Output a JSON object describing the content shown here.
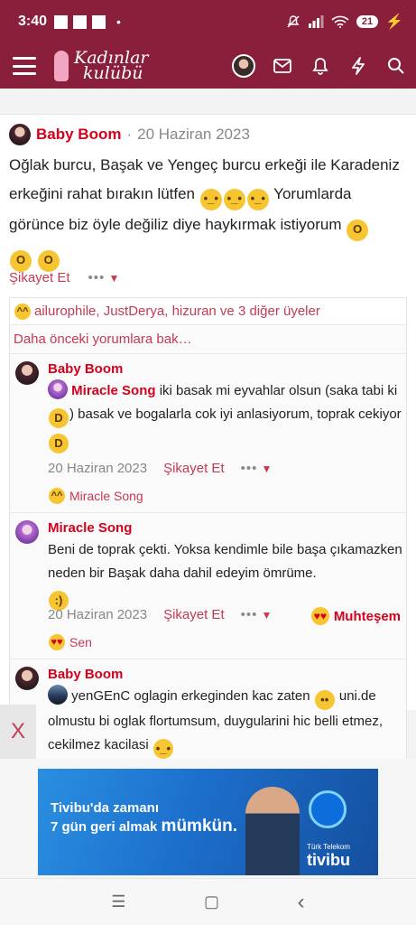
{
  "status_bar": {
    "time": "3:40",
    "battery": "21"
  },
  "app_bar": {
    "logo_line1": "Kadınlar",
    "logo_line2": "kulübü"
  },
  "post": {
    "author": "Baby Boom",
    "separator": "·",
    "date": "20 Haziran 2023",
    "text_part1": "Oğlak burcu, Başak ve Yengeç burcu erkeği ile Karadeniz erkeğini rahat bırakın lütfen",
    "text_part2": "Yorumlarda görünce biz öyle değiliz diye haykırmak istiyorum",
    "report_label": "Şikayet Et",
    "more_label": "•••"
  },
  "reactions_summary": "ailurophile, JustDerya, hizuran ve 3 diğer üyeler",
  "older_comments_label": "Daha önceki yorumlara bak…",
  "comments": [
    {
      "author": "Baby Boom",
      "mention": "Miracle Song",
      "text_part1": "iki basak mi eyvahlar olsun (saka tabi ki",
      "text_part2": ") basak ve bogalarla cok iyi anlasiyorum, toprak cekiyor",
      "date": "20 Haziran 2023",
      "report_label": "Şikayet Et",
      "more_label": "•••",
      "reactor": "Miracle Song"
    },
    {
      "author": "Miracle Song",
      "text": "Beni de toprak çekti. Yoksa kendimle bile başa çıkamazken neden bir Başak daha dahil edeyim ömrüme.",
      "date": "20 Haziran 2023",
      "report_label": "Şikayet Et",
      "more_label": "•••",
      "reaction_label": "Muhteşem",
      "reactor": "Sen"
    },
    {
      "author": "Baby Boom",
      "mention": "yenGEnC",
      "text_part1": "oglagin erkeginden kac zaten",
      "text_part2": "uni.de olmustu bi oglak flortumsum, duygularini hic belli etmez, cekilmez kacilasi"
    }
  ],
  "close_tab_label": "X",
  "ad": {
    "line1": "Tivibu'da zamanı",
    "line2_a": "7 gün geri almak",
    "line2_b": "mümkün.",
    "brand_small": "Türk Telekom",
    "brand_name": "tivibu"
  },
  "nav": {
    "menu_glyph": "☰",
    "home_glyph": "▢",
    "back_glyph": "‹"
  },
  "colors": {
    "brand": "#8a1f3c",
    "accent": "#d6001c",
    "link": "#c43a55"
  }
}
